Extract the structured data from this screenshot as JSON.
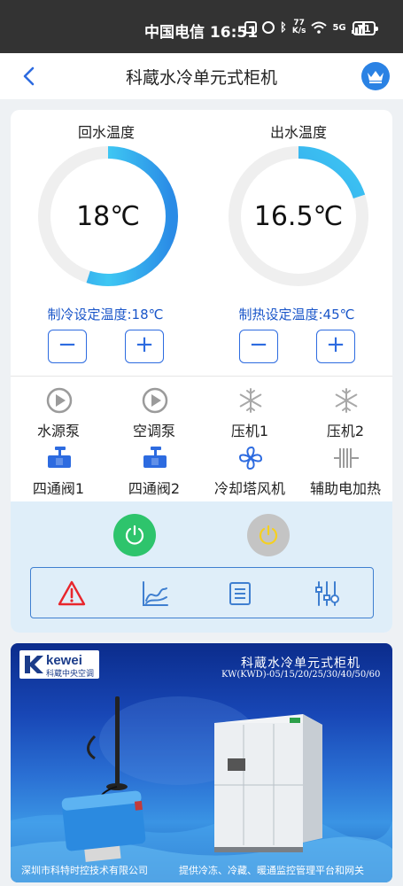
{
  "status_bar": {
    "carrier_time": "中国电信 16:51",
    "speed_value": "77",
    "speed_unit": "K/s",
    "network": "5G",
    "battery": "71"
  },
  "header": {
    "title": "科蔵水冷单元式柜机"
  },
  "gauges": {
    "return_water": {
      "label": "回水温度",
      "value": "18℃",
      "fill_fraction": 0.55
    },
    "outlet_water": {
      "label": "出水温度",
      "value": "16.5℃",
      "fill_fraction": 0.2
    }
  },
  "setpoints": {
    "cooling": {
      "label": "制冷设定温度:18℃"
    },
    "heating": {
      "label": "制热设定温度:45℃"
    }
  },
  "stepper": {
    "minus": "−",
    "plus": "+"
  },
  "devices": [
    {
      "label": "水源泵",
      "icon": "pump-play-icon"
    },
    {
      "label": "空调泵",
      "icon": "pump-play-icon"
    },
    {
      "label": "压机1",
      "icon": "snowflake-icon"
    },
    {
      "label": "压机2",
      "icon": "snowflake-icon"
    },
    {
      "label": "四通阀1",
      "icon": "valve-icon"
    },
    {
      "label": "四通阀2",
      "icon": "valve-icon"
    },
    {
      "label": "冷却塔风机",
      "icon": "fan-icon"
    },
    {
      "label": "辅助电加热",
      "icon": "heater-icon"
    }
  ],
  "colors": {
    "accent": "#2d6be0",
    "gauge_arc": "#35b6f0",
    "gauge_track": "#efefef",
    "power_on": "#2ec46c",
    "power_off": "#c4c4c4",
    "power_off_symbol": "#f5d020",
    "alarm": "#e8262c"
  },
  "toolbar": [
    "alarm-icon",
    "chart-icon",
    "list-icon",
    "settings-sliders-icon"
  ],
  "banner": {
    "brand": "kewei",
    "brand_sub": "科蔵中央空调",
    "title": "科蔵水冷单元式柜机",
    "models": "KW(KWD)-05/15/20/25/30/40/50/60",
    "company": "深圳市科特时控技术有限公司",
    "slogan": "提供冷冻、冷藏、暖通监控管理平台和网关"
  }
}
